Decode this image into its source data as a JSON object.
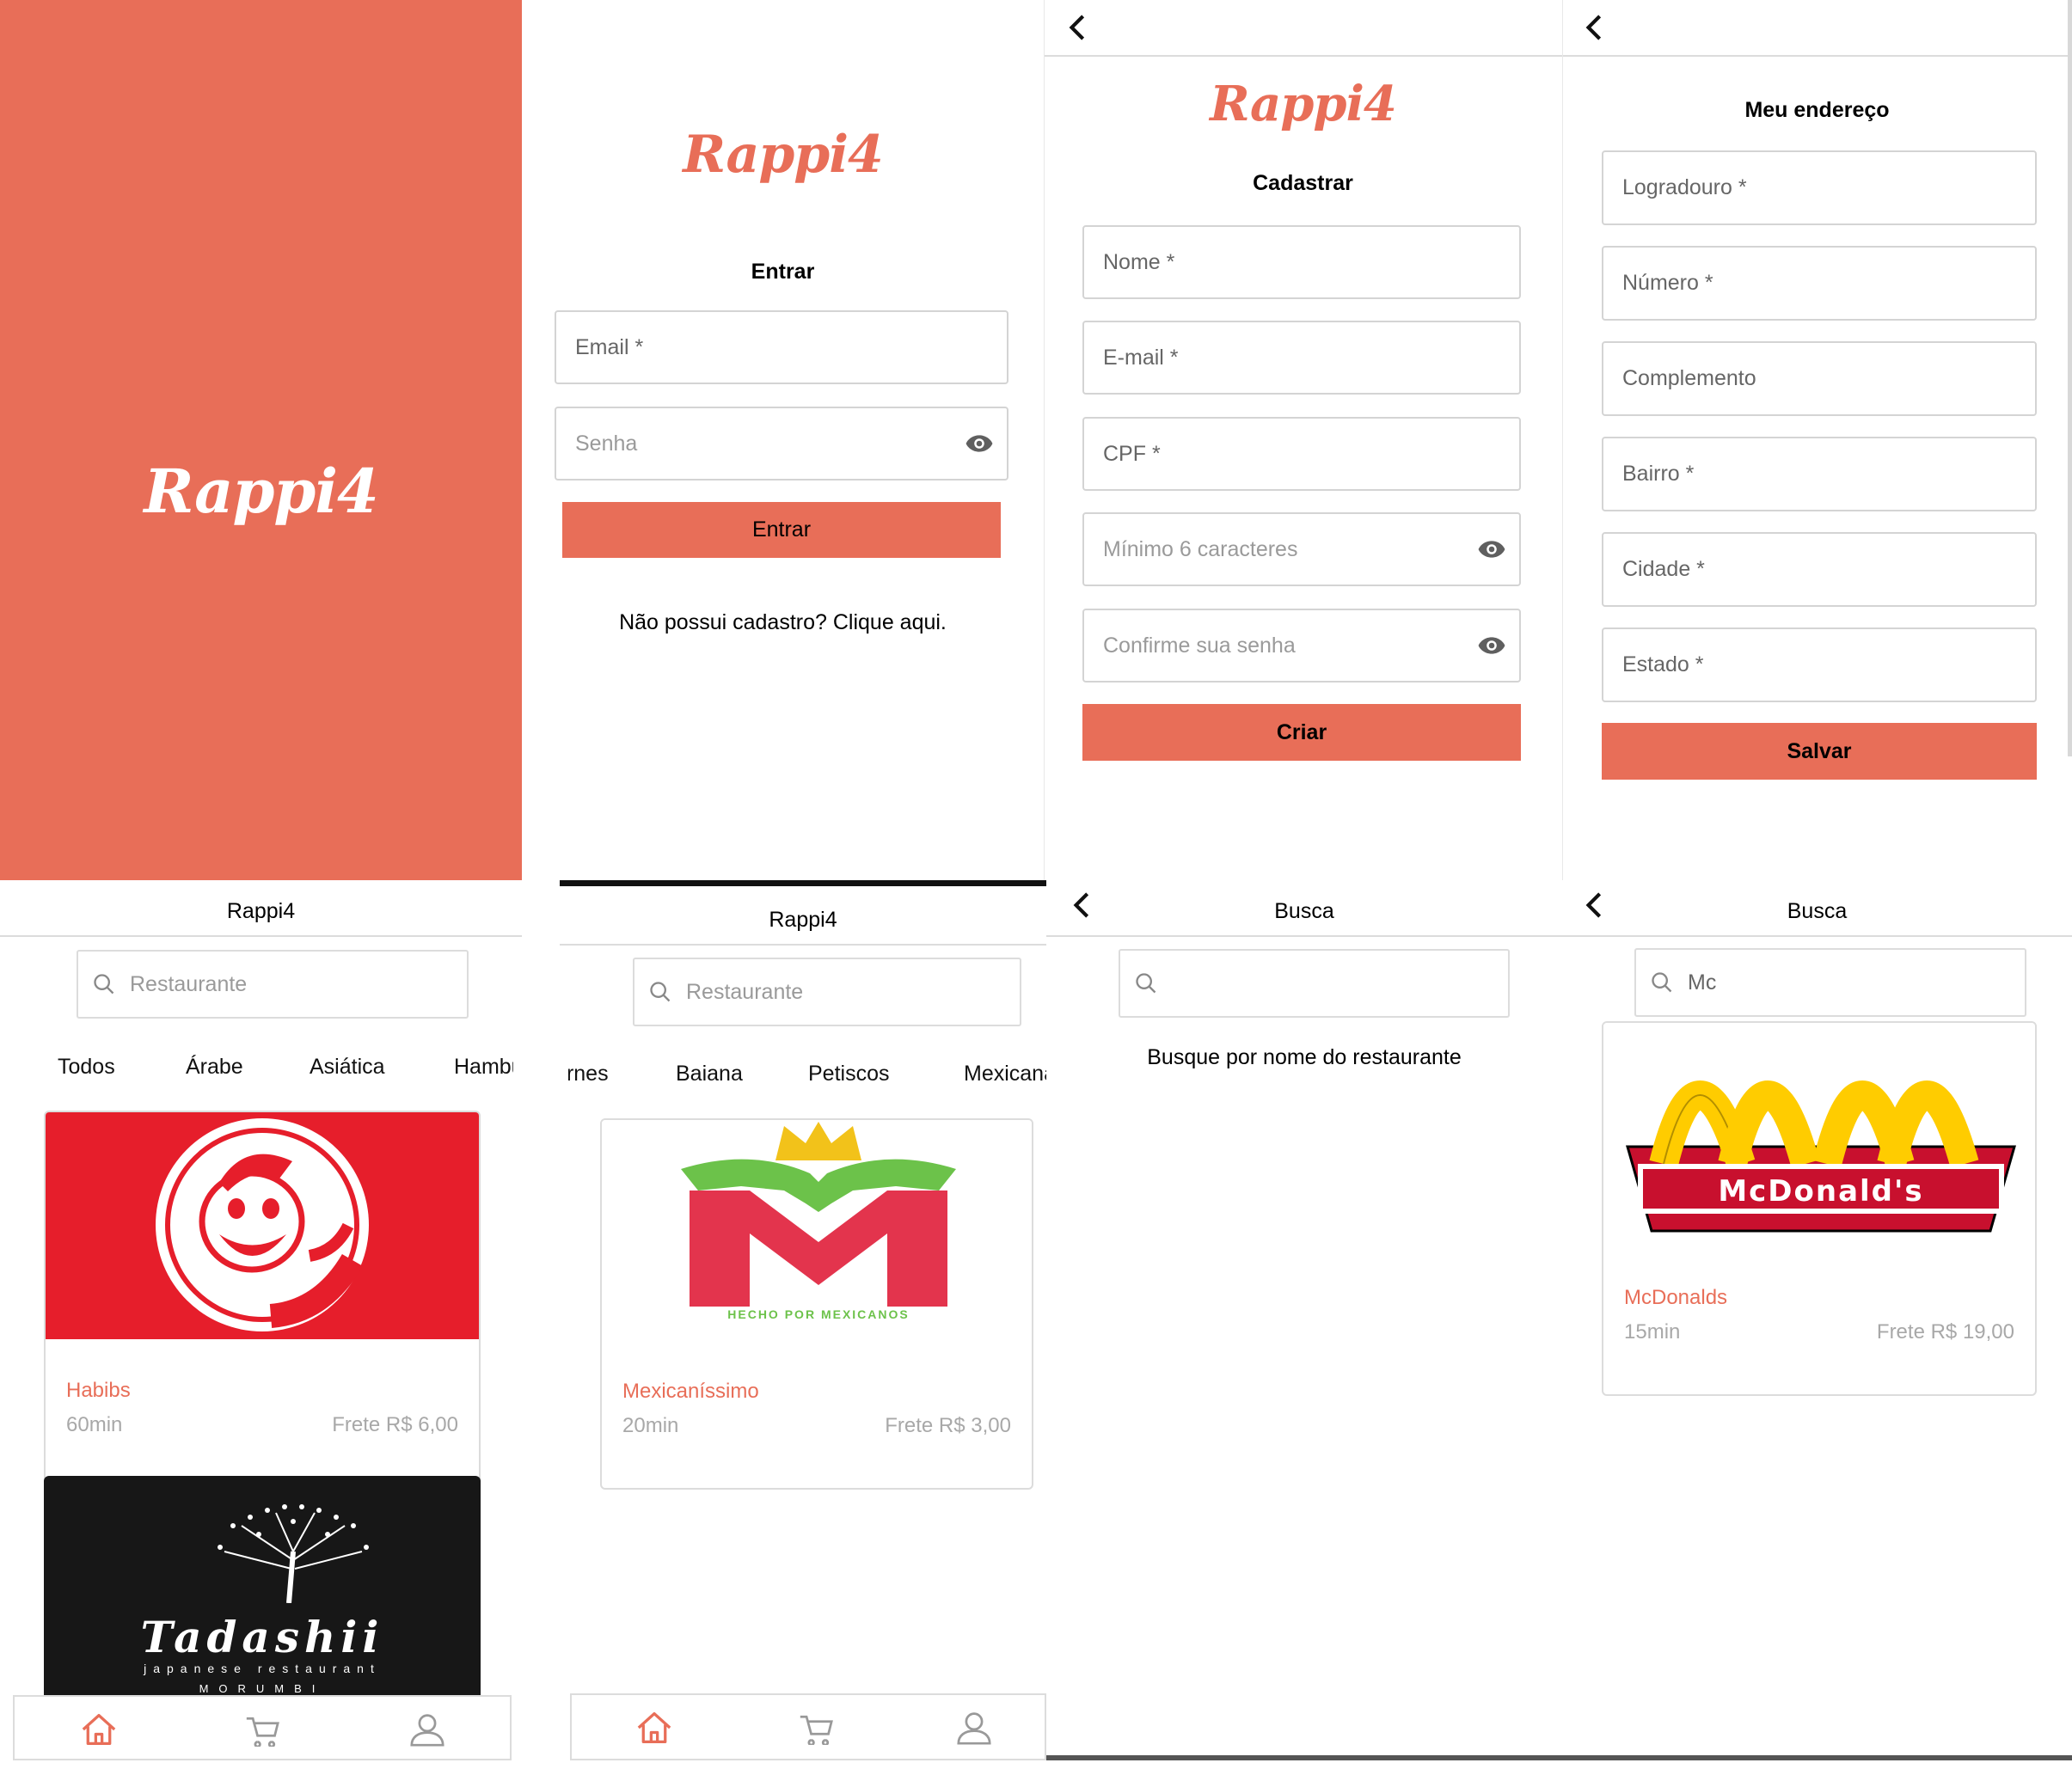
{
  "brand": {
    "logo_text": "Rappi4",
    "accent_color": "#e86e58"
  },
  "login": {
    "heading": "Entrar",
    "email_label": "Email *",
    "password_placeholder": "Senha",
    "submit_label": "Entrar",
    "signup_prompt": "Não possui cadastro? Clique aqui."
  },
  "signup": {
    "heading": "Cadastrar",
    "name_label": "Nome *",
    "email_label": "E-mail *",
    "cpf_label": "CPF *",
    "password_placeholder": "Mínimo 6 caracteres",
    "confirm_placeholder": "Confirme sua senha",
    "submit_label": "Criar"
  },
  "address": {
    "heading": "Meu endereço",
    "street_label": "Logradouro *",
    "number_label": "Número *",
    "complement_label": "Complemento",
    "district_label": "Bairro *",
    "city_label": "Cidade *",
    "state_label": "Estado *",
    "submit_label": "Salvar"
  },
  "feed": {
    "header_title": "Rappi4",
    "search_placeholder": "Restaurante",
    "categories": [
      "Todos",
      "Árabe",
      "Asiática",
      "Hamburguer"
    ],
    "restaurants": [
      {
        "name": "Habibs",
        "time": "60min",
        "fee": "Frete R$ 6,00",
        "logo": "habibs-logo"
      },
      {
        "name": "Tadashii",
        "logo": "tadashii-logo",
        "logo_title": "Tadashii",
        "logo_subtitle": "japanese restaurant",
        "logo_location": "MORUMBI"
      }
    ]
  },
  "feed2": {
    "header_title": "Rappi4",
    "search_placeholder": "Restaurante",
    "categories": [
      "Carnes",
      "Baiana",
      "Petiscos",
      "Mexicana"
    ],
    "restaurants": [
      {
        "name": "Mexicaníssimo",
        "time": "20min",
        "fee": "Frete R$ 3,00",
        "logo": "mexicanissimo-logo",
        "logo_tagline": "HECHO POR MEXICANOS"
      }
    ]
  },
  "search_empty": {
    "header_title": "Busca",
    "search_value": "",
    "hint": "Busque por nome do restaurante"
  },
  "search_result": {
    "header_title": "Busca",
    "search_value": "Mc",
    "restaurants": [
      {
        "name": "McDonalds",
        "time": "15min",
        "fee": "Frete R$ 19,00",
        "logo": "mcdonalds-logo",
        "logo_text": "McDonald's"
      }
    ]
  },
  "bottom_nav": {
    "items": [
      "home-icon",
      "cart-icon",
      "profile-icon"
    ],
    "active": "home-icon"
  }
}
